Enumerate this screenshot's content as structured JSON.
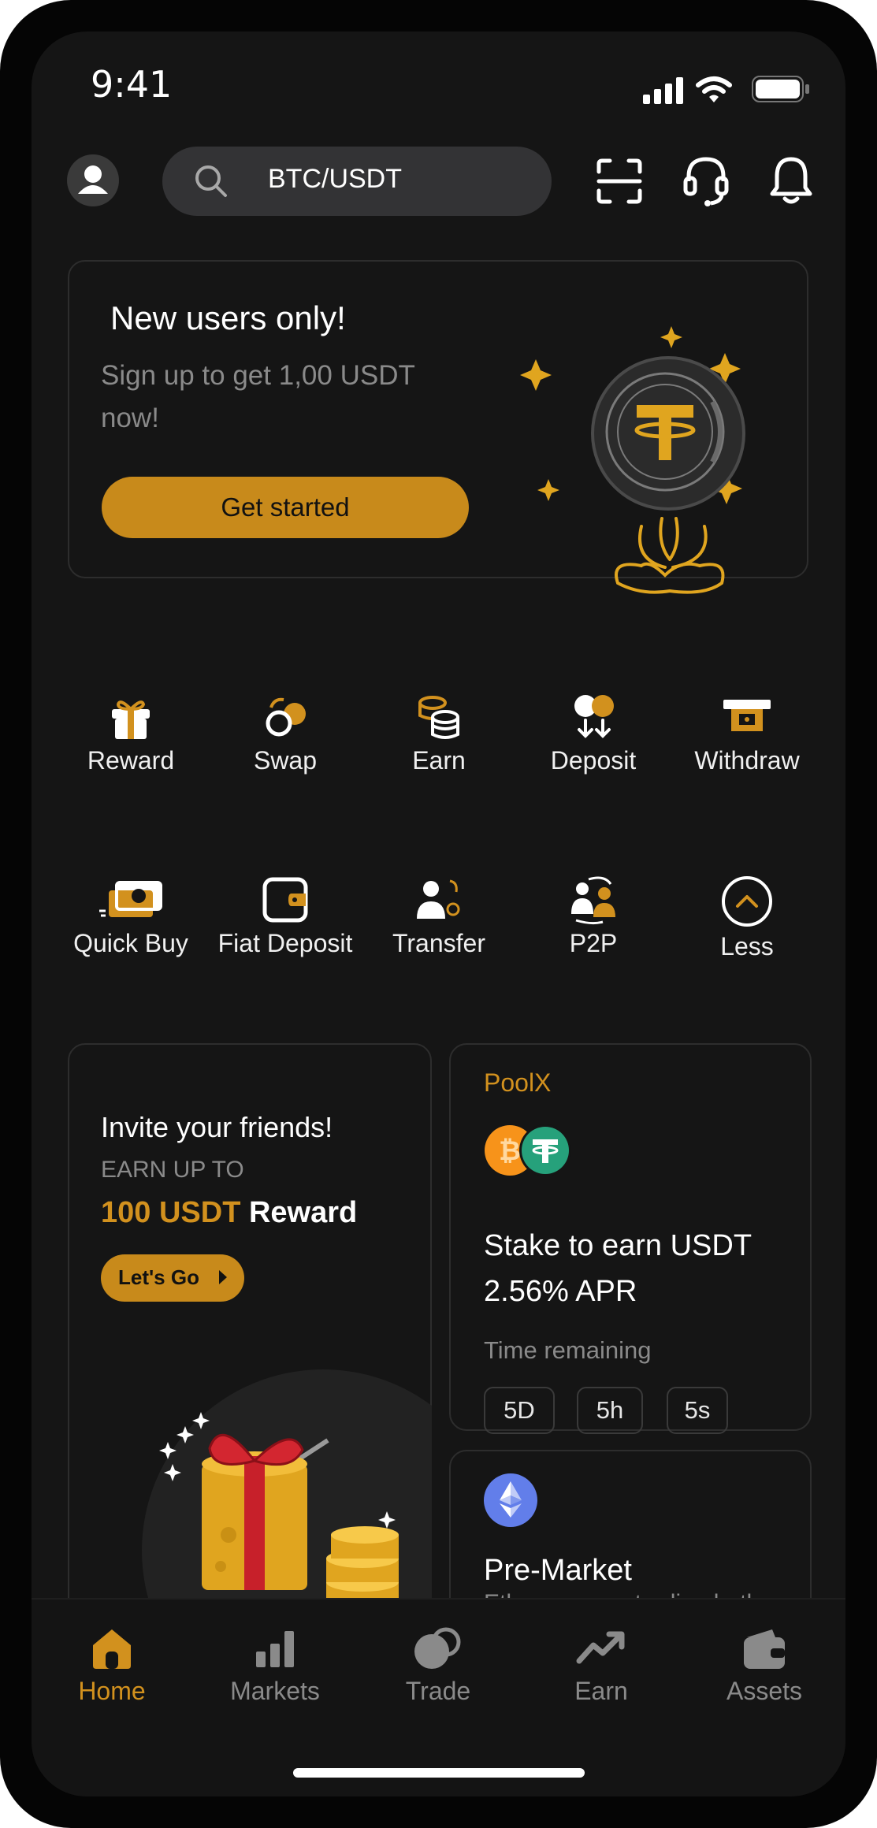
{
  "status_bar": {
    "time": "9:41"
  },
  "header": {
    "search_value": "BTC/USDT"
  },
  "banner": {
    "title": "New users only!",
    "subtitle": "Sign up to get 1,00 USDT now!",
    "button": "Get started"
  },
  "actions": [
    {
      "label": "Reward",
      "icon": "gift-icon"
    },
    {
      "label": "Swap",
      "icon": "swap-icon"
    },
    {
      "label": "Earn",
      "icon": "coins-icon"
    },
    {
      "label": "Deposit",
      "icon": "deposit-icon"
    },
    {
      "label": "Withdraw",
      "icon": "withdraw-icon"
    },
    {
      "label": "Quick Buy",
      "icon": "cash-icon"
    },
    {
      "label": "Fiat Deposit",
      "icon": "wallet-icon"
    },
    {
      "label": "Transfer",
      "icon": "transfer-icon"
    },
    {
      "label": "P2P",
      "icon": "p2p-icon"
    },
    {
      "label": "Less",
      "icon": "chevron-up-icon"
    }
  ],
  "invite_card": {
    "title": "Invite your friends!",
    "earn_up_to": "EARN UP TO",
    "amount": "100 USDT",
    "reward": "Reward",
    "button": "Let's Go"
  },
  "poolx_card": {
    "brand": "PoolX",
    "title": "Stake to earn USDT",
    "apr": "2.56% APR",
    "time_label": "Time remaining",
    "days": "5D",
    "hours": "5h",
    "seconds": "5s"
  },
  "premarket_card": {
    "title": "Pre-Market",
    "description": "Ethereum pre-trading both"
  },
  "tabs": [
    {
      "label": "Home",
      "active": true
    },
    {
      "label": "Markets",
      "active": false
    },
    {
      "label": "Trade",
      "active": false
    },
    {
      "label": "Earn",
      "active": false
    },
    {
      "label": "Assets",
      "active": false
    }
  ],
  "colors": {
    "accent": "#c88a1b",
    "background": "#151515",
    "muted": "#8a8a8a"
  }
}
